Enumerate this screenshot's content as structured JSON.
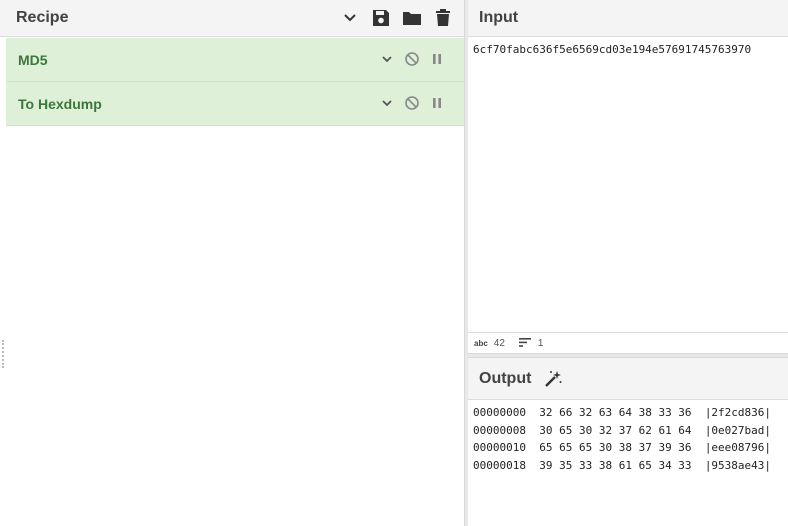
{
  "recipe": {
    "title": "Recipe",
    "header_icons": [
      "chevron-down-icon",
      "save-icon",
      "folder-icon",
      "trash-icon"
    ],
    "operations": [
      {
        "name": "MD5"
      },
      {
        "name": "To Hexdump"
      }
    ]
  },
  "input": {
    "title": "Input",
    "value": "6cf70fabc636f5e6569cd03e194e57691745763970",
    "status": {
      "abc_label": "abc",
      "length": "42",
      "lines": "1"
    }
  },
  "output": {
    "title": "Output",
    "rows": [
      {
        "offset": "00000000",
        "bytes": "32 66 32 63 64 38 33 36",
        "ascii": "|2f2cd836|"
      },
      {
        "offset": "00000008",
        "bytes": "30 65 30 32 37 62 61 64",
        "ascii": "|0e027bad|"
      },
      {
        "offset": "00000010",
        "bytes": "65 65 65 30 38 37 39 36",
        "ascii": "|eee08796|"
      },
      {
        "offset": "00000018",
        "bytes": "39 35 33 38 61 65 34 33",
        "ascii": "|9538ae43|"
      }
    ]
  },
  "colors": {
    "op_bg": "#dff0d8",
    "op_text": "#3c763d",
    "header_bg": "#f4f4f4"
  }
}
